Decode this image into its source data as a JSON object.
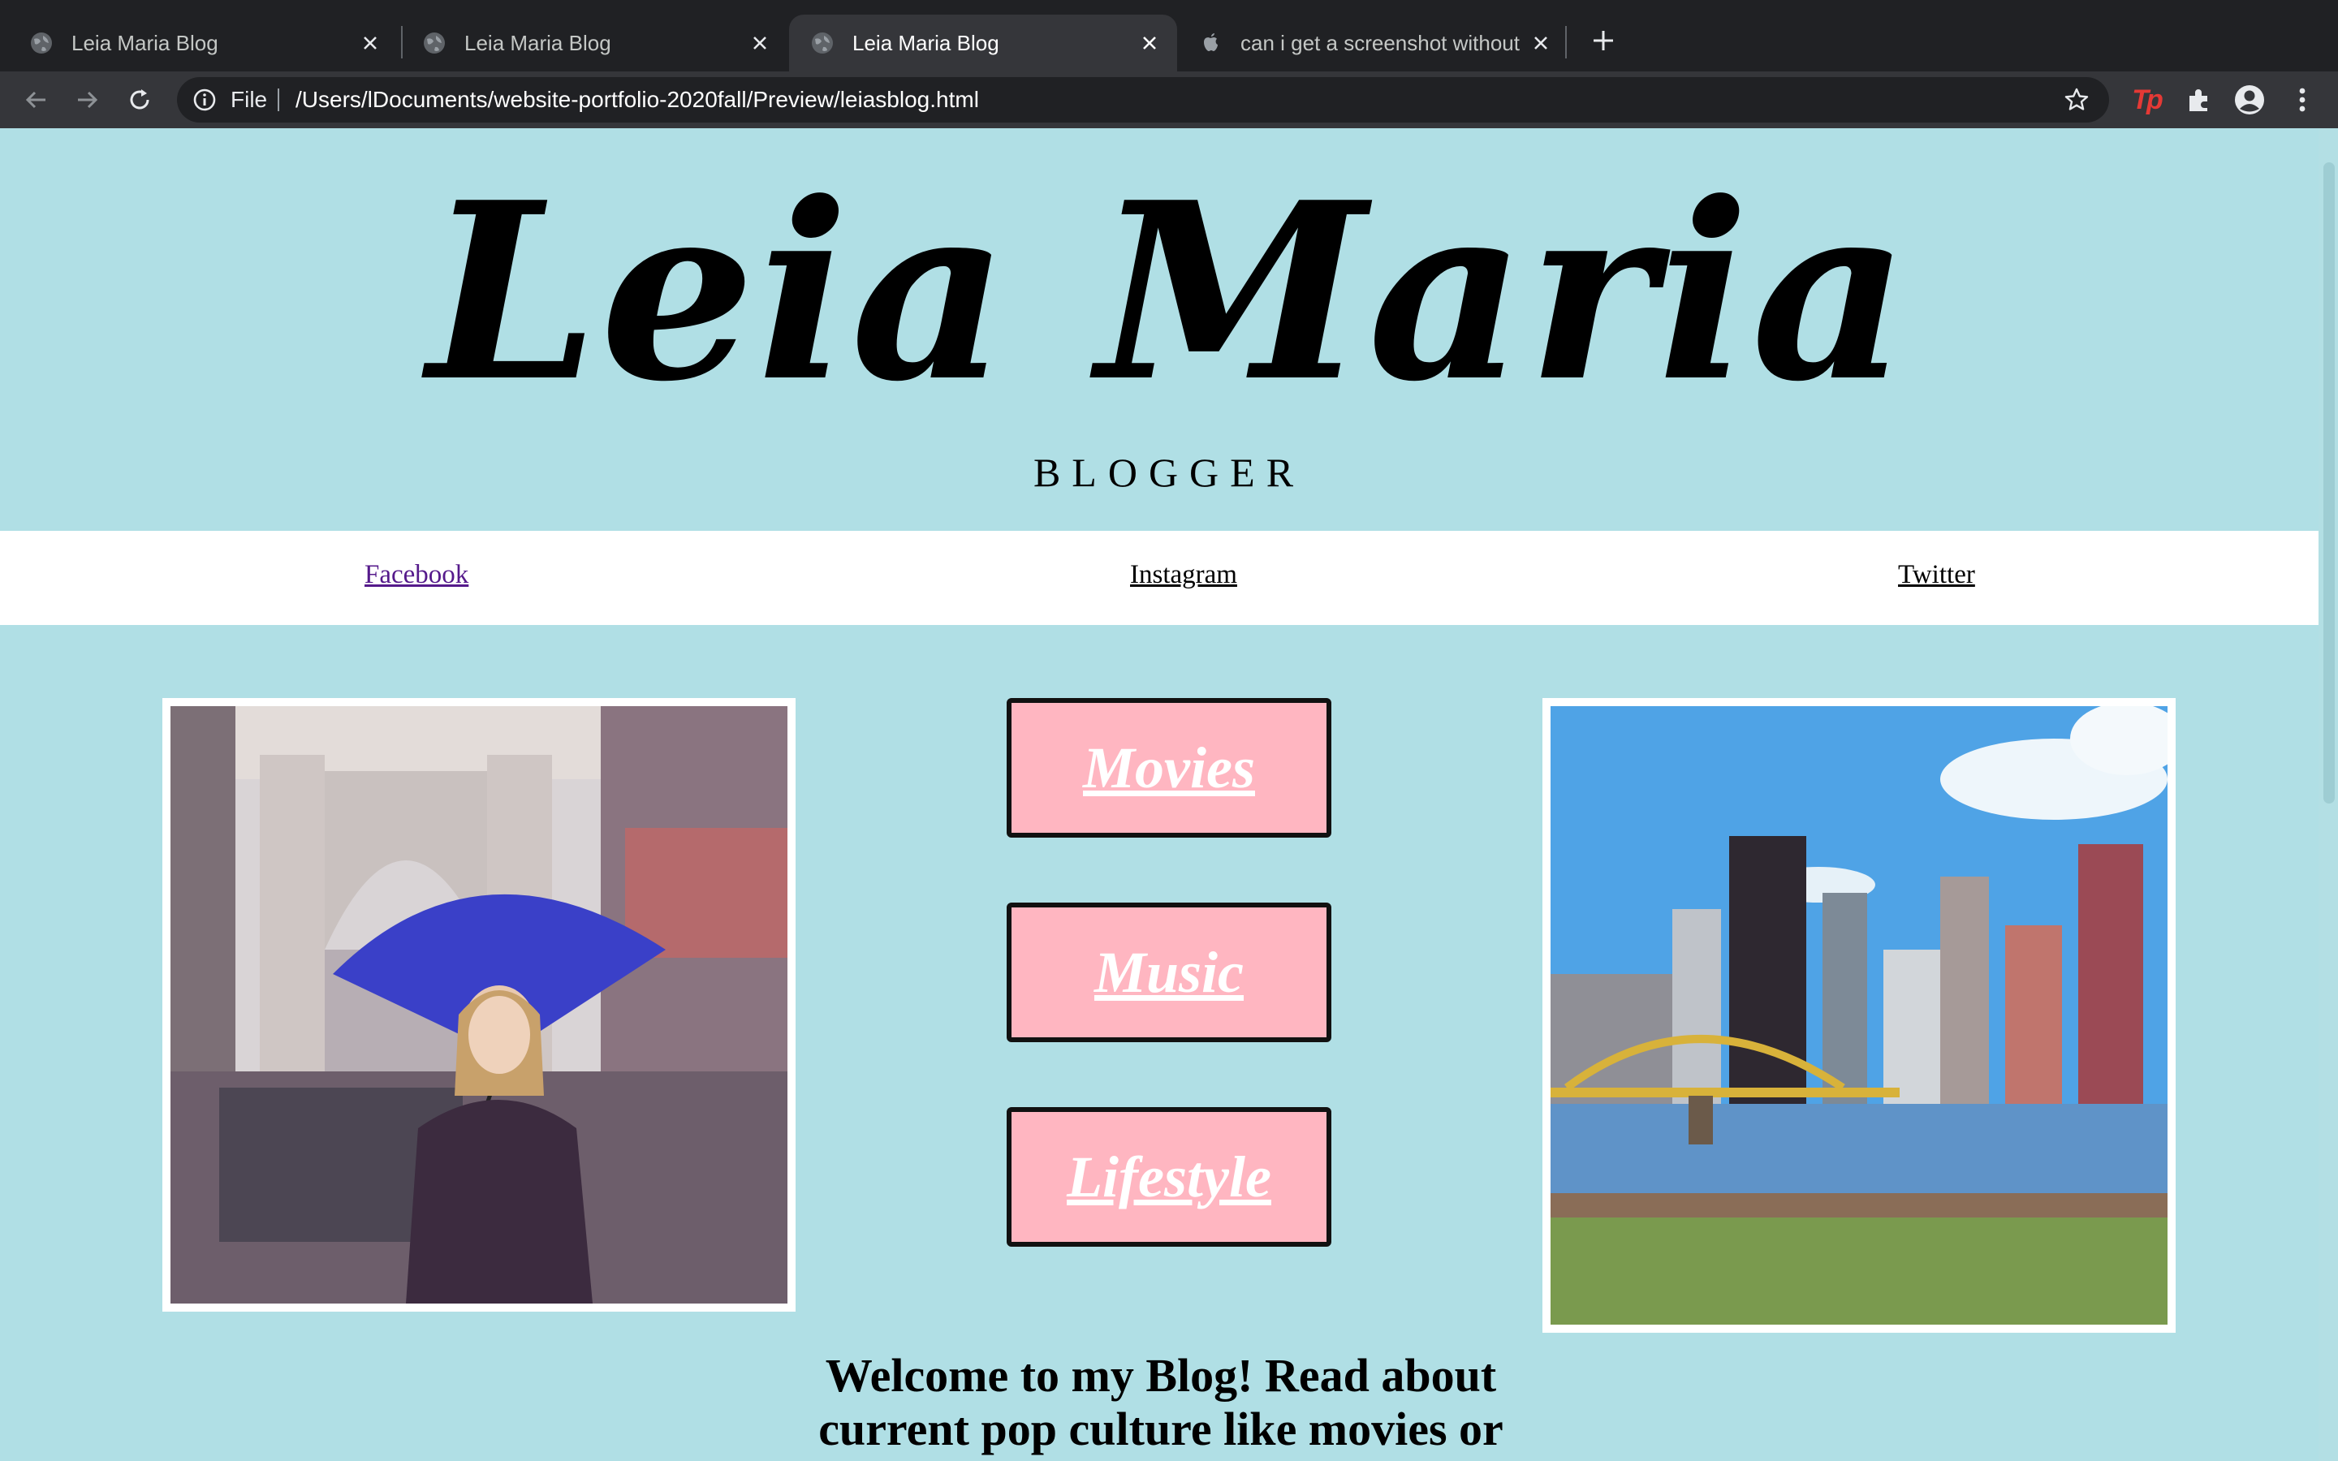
{
  "browser": {
    "tabs": [
      {
        "title": "Leia Maria Blog",
        "active": false
      },
      {
        "title": "Leia Maria Blog",
        "active": false
      },
      {
        "title": "Leia Maria Blog",
        "active": true
      },
      {
        "title": "can i get a screenshot without",
        "active": false
      }
    ],
    "omnibox": {
      "scheme": "File",
      "url": "/Users/lDocuments/website-portfolio-2020fall/Preview/leiasblog.html"
    },
    "extension_label": "Tp"
  },
  "page": {
    "logo": "Leia Maria",
    "subtitle": "BLOGGER",
    "social_links": [
      "Facebook",
      "Instagram",
      "Twitter"
    ],
    "categories": [
      "Movies",
      "Music",
      "Lifestyle"
    ],
    "welcome_text": "Welcome to my Blog! Read about current pop culture like movies or",
    "colors": {
      "background": "#b0dfe5",
      "button_fill": "#ffb6c1",
      "visited_link": "#551a8b"
    }
  }
}
